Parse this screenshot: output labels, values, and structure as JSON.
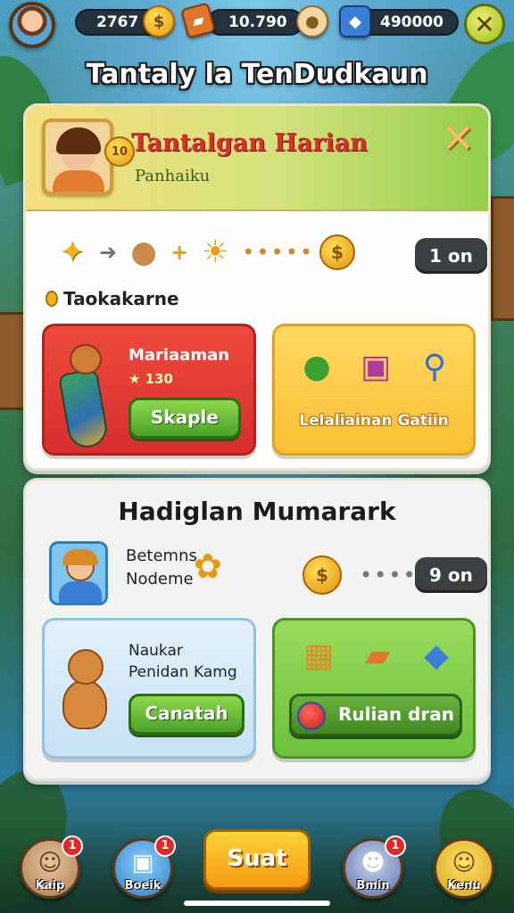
{
  "resources": [
    {
      "name": "resource-1",
      "value": "2767",
      "icon": "coin-icon",
      "color": "#f4b21a"
    },
    {
      "name": "resource-2",
      "value": "10.790",
      "icon": "cookie-icon",
      "color": "#e3c190"
    },
    {
      "name": "resource-3",
      "value": "490000",
      "icon": "shield-gem-icon",
      "color": "#3a7fd6"
    }
  ],
  "page": {
    "title": "Tantaly la TenDudkaun"
  },
  "quest_panel": {
    "title": "Tantalgan Harian",
    "subtitle": "Panhaiku",
    "badge": "10",
    "timer": "1 on",
    "section_label": "Taokakarne",
    "card_red": {
      "title": "Mariaaman",
      "meta": "★ 130",
      "button": "Skaple"
    },
    "card_yellow": {
      "label": "Lelaliainan Gatiin"
    }
  },
  "bonus_panel": {
    "title": "Hadiglan Mumarark",
    "task_line1": "Betemns",
    "task_line2": "Nodeme",
    "timer": "9 on",
    "card_blue": {
      "line1": "Naukar",
      "line2": "Penidan Kamg",
      "button": "Canatah"
    },
    "card_green": {
      "button": "Rulian dran"
    }
  },
  "bottom_nav": {
    "items": [
      {
        "label": "Kaip",
        "badge": "1"
      },
      {
        "label": "Boeik",
        "badge": "1"
      },
      {
        "label": "Bmin",
        "badge": "1"
      },
      {
        "label": "Kenu",
        "badge": ""
      }
    ],
    "center": "Suat"
  },
  "colors": {
    "accent_green": "#4aa12a",
    "accent_red": "#d72e2e",
    "accent_yellow": "#f9c034",
    "accent_blue": "#2a7ec2"
  }
}
